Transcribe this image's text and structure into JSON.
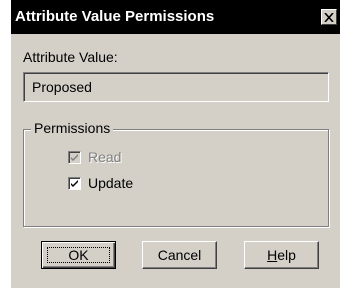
{
  "dialog": {
    "title": "Attribute Value Permissions",
    "close_icon": "close-icon",
    "attribute_value_label": "Attribute Value:",
    "attribute_value": "Proposed",
    "permissions_label": "Permissions",
    "permissions": [
      {
        "label": "Read",
        "checked": true,
        "enabled": false
      },
      {
        "label": "Update",
        "checked": true,
        "enabled": true
      }
    ],
    "buttons": {
      "ok": "OK",
      "cancel": "Cancel",
      "help_first": "H",
      "help_rest": "elp"
    }
  }
}
